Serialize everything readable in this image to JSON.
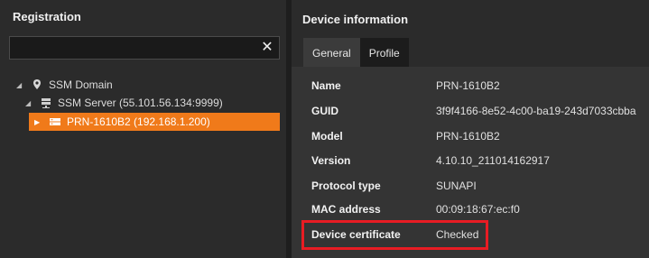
{
  "registration": {
    "title": "Registration",
    "search_value": "",
    "tree": [
      {
        "label": "SSM Domain",
        "icon": "location-pin-icon"
      },
      {
        "label": "SSM Server (55.101.56.134:9999)",
        "icon": "server-icon"
      },
      {
        "label": "PRN-1610B2 (192.168.1.200)",
        "icon": "device-icon",
        "selected": true
      }
    ]
  },
  "device_info": {
    "title": "Device information",
    "tabs": [
      {
        "label": "General",
        "active": true
      },
      {
        "label": "Profile",
        "active": false
      }
    ],
    "fields": [
      {
        "label": "Name",
        "value": "PRN-1610B2"
      },
      {
        "label": "GUID",
        "value": "3f9f4166-8e52-4c00-ba19-243d7033cbba"
      },
      {
        "label": "Model",
        "value": "PRN-1610B2"
      },
      {
        "label": "Version",
        "value": "4.10.10_211014162917"
      },
      {
        "label": "Protocol type",
        "value": "SUNAPI"
      },
      {
        "label": "MAC address",
        "value": "00:09:18:67:ec:f0"
      },
      {
        "label": "Device certificate",
        "value": "Checked"
      }
    ]
  },
  "colors": {
    "selected_row": "#f07a1a",
    "highlight_border": "#e81c23"
  }
}
